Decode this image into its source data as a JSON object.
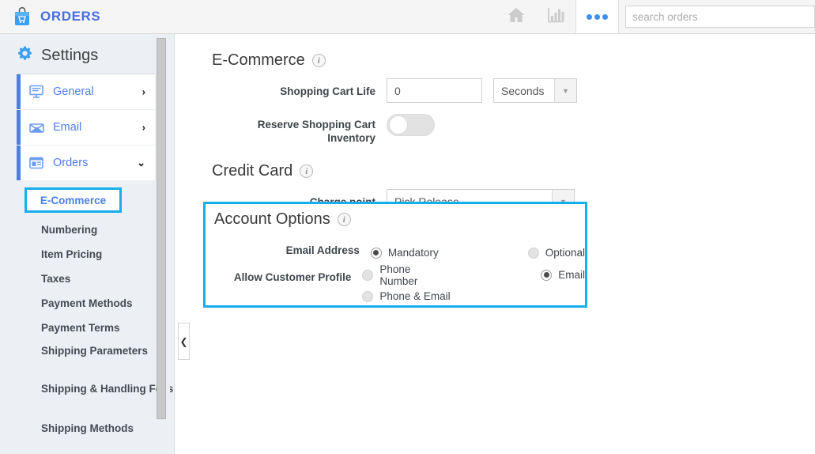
{
  "topbar": {
    "brand_icon": "shopping-bag-icon",
    "brand_title": "ORDERS",
    "home_icon": "home-icon",
    "reports_icon": "bar-chart-icon",
    "more_icon": "three-dots-icon",
    "search_placeholder": "search orders",
    "search_value": ""
  },
  "sidebar": {
    "title": "Settings",
    "gear_icon": "gear-icon",
    "nav": [
      {
        "label": "General",
        "icon": "monitor-icon",
        "chevron": "›"
      },
      {
        "label": "Email",
        "icon": "envelope-icon",
        "chevron": "›"
      },
      {
        "label": "Orders",
        "icon": "document-icon",
        "chevron": "⌄"
      }
    ],
    "sub_items": [
      "E-Commerce",
      "Numbering",
      "Item Pricing",
      "Taxes",
      "Payment Methods",
      "Payment Terms",
      "Shipping Parameters",
      "Shipping & Handling Fees",
      "Shipping Methods"
    ],
    "active_sub_item": "E-Commerce",
    "collapse_icon": "chevron-left-icon"
  },
  "main": {
    "ecommerce": {
      "heading": "E-Commerce",
      "info_icon": "info-icon",
      "cart_life_label": "Shopping Cart Life",
      "cart_life_value": "0",
      "cart_life_unit": "Seconds",
      "reserve_label": "Reserve Shopping Cart Inventory",
      "reserve_state": "off"
    },
    "credit_card": {
      "heading": "Credit Card",
      "info_icon": "info-icon",
      "charge_point_label": "Charge point",
      "charge_point_value": "Pick Release"
    },
    "account_options": {
      "heading": "Account Options",
      "info_icon": "info-icon",
      "email_address_label": "Email Address",
      "email_address_options": [
        "Mandatory",
        "Optional"
      ],
      "email_address_selected": "Mandatory",
      "profile_label": "Allow Customer Profile",
      "profile_options": [
        "Phone Number",
        "Email",
        "Phone & Email"
      ],
      "profile_selected": "Email"
    }
  },
  "colors": {
    "accent_blue": "#4a7fe8",
    "highlight_cyan": "#17aeea",
    "brand_blue": "#4a6ee0"
  }
}
